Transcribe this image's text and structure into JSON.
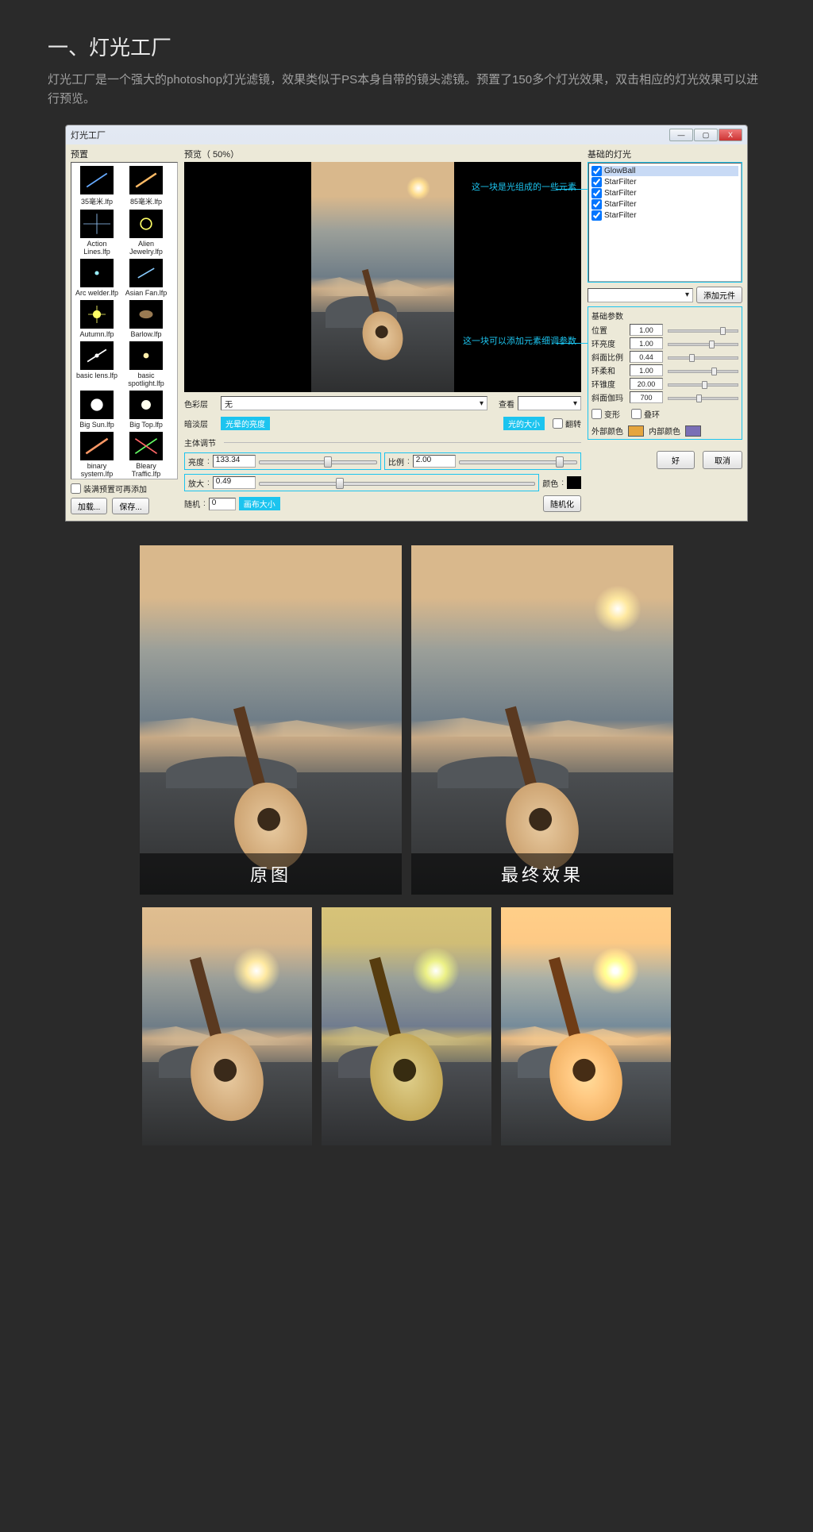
{
  "heading": "一、灯光工厂",
  "sub": "灯光工厂是一个强大的photoshop灯光滤镜，效果类似于PS本身自带的镜头滤镜。预置了150多个灯光效果，双击相应的灯光效果可以进行预览。",
  "window": {
    "title": "灯光工厂",
    "btn_min": "—",
    "btn_max": "▢",
    "btn_close": "X"
  },
  "left": {
    "title": "预置",
    "presets": [
      "35毫米.lfp",
      "85毫米.lfp",
      "Action Lines.lfp",
      "Alien Jewelry.lfp",
      "Arc welder.lfp",
      "Asian Fan.lfp",
      "Autumn.lfp",
      "Barlow.lfp",
      "basic lens.lfp",
      "basic spotlight.lfp",
      "Big Sun.lfp",
      "Big Top.lfp",
      "binary system.lfp",
      "Bleary Traffic.lfp"
    ],
    "chk_fill": "装满预置可再添加",
    "btn_load": "加载...",
    "btn_save": "保存..."
  },
  "mid": {
    "title": "预览（ 50%）",
    "annot1": "这一块是光组成的一些元素",
    "annot2": "这一块可以添加元素细调参数",
    "color_layer": "色彩层",
    "none": "无",
    "view": "查看",
    "dark_layer": "暗淡层",
    "chk_flip": "翻转",
    "body_adjust": "主体调节",
    "tag_brightness": "光晕的亮度",
    "tag_size": "光的大小",
    "tag_canvas": "画布大小",
    "brightness": "亮度",
    "brightness_val": "133.34",
    "ratio": "比例",
    "ratio_val": "2.00",
    "zoom": "放大",
    "zoom_val": "0.49",
    "color": "颜色",
    "random": "随机",
    "random_val": "0",
    "btn_random": "随机化"
  },
  "right": {
    "title": "基础的灯光",
    "items": [
      "GlowBall",
      "StarFilter",
      "StarFilter",
      "StarFilter",
      "StarFilter"
    ],
    "btn_add": "添加元件",
    "params_title": "基础参数",
    "params": [
      {
        "l": "位置",
        "v": "1.00",
        "k": 74
      },
      {
        "l": "环亮度",
        "v": "1.00",
        "k": 58
      },
      {
        "l": "斜面比例",
        "v": "0.44",
        "k": 30
      },
      {
        "l": "环柔和",
        "v": "1.00",
        "k": 62
      },
      {
        "l": "环锥度",
        "v": "20.00",
        "k": 48
      },
      {
        "l": "斜面伽玛",
        "v": "700",
        "k": 40
      }
    ],
    "chk_deform": "变形",
    "chk_ring": "叠环",
    "out_color": "外部颜色",
    "in_color": "内部颜色",
    "out_sw": "#e5a53e",
    "in_sw": "#7a6fb6",
    "btn_ok": "好",
    "btn_cancel": "取消"
  },
  "compare": {
    "orig": "原图",
    "final": "最终效果"
  }
}
